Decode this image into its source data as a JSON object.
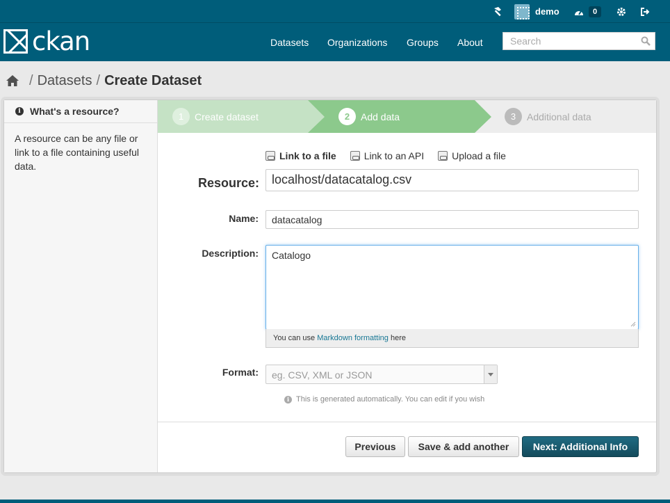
{
  "account": {
    "username": "demo",
    "dashboard_count": "0"
  },
  "brand": {
    "logo_text": "ckan"
  },
  "nav": {
    "items": [
      "Datasets",
      "Organizations",
      "Groups",
      "About"
    ],
    "search_placeholder": "Search"
  },
  "breadcrumb": {
    "items": [
      "Datasets"
    ],
    "active": "Create Dataset",
    "separator": "/"
  },
  "sidebar": {
    "title": "What's a resource?",
    "body": "A resource can be any file or link to a file containing useful data."
  },
  "stages": [
    {
      "number": "1",
      "label": "Create dataset",
      "state": "complete"
    },
    {
      "number": "2",
      "label": "Add data",
      "state": "active"
    },
    {
      "number": "3",
      "label": "Additional data",
      "state": "pending"
    }
  ],
  "resource_tabs": {
    "link_file": "Link to a file",
    "link_api": "Link to an API",
    "upload_file": "Upload a file"
  },
  "form": {
    "resource_label": "Resource:",
    "resource_value": "localhost/datacatalog.csv",
    "name_label": "Name:",
    "name_value": "datacatalog",
    "description_label": "Description:",
    "description_value": "Catalogo",
    "markdown_prefix": "You can use ",
    "markdown_link": "Markdown formatting",
    "markdown_suffix": " here",
    "format_label": "Format:",
    "format_placeholder": "eg. CSV, XML or JSON",
    "format_hint": "This is generated automatically. You can edit if you wish"
  },
  "actions": {
    "previous": "Previous",
    "save_add_another": "Save & add another",
    "next": "Next: Additional Info"
  },
  "colors": {
    "masthead": "#005d7a",
    "stage_complete": "#c5e2c5",
    "stage_active": "#8cc98c",
    "primary_button": "#206b82",
    "link": "#187794"
  }
}
